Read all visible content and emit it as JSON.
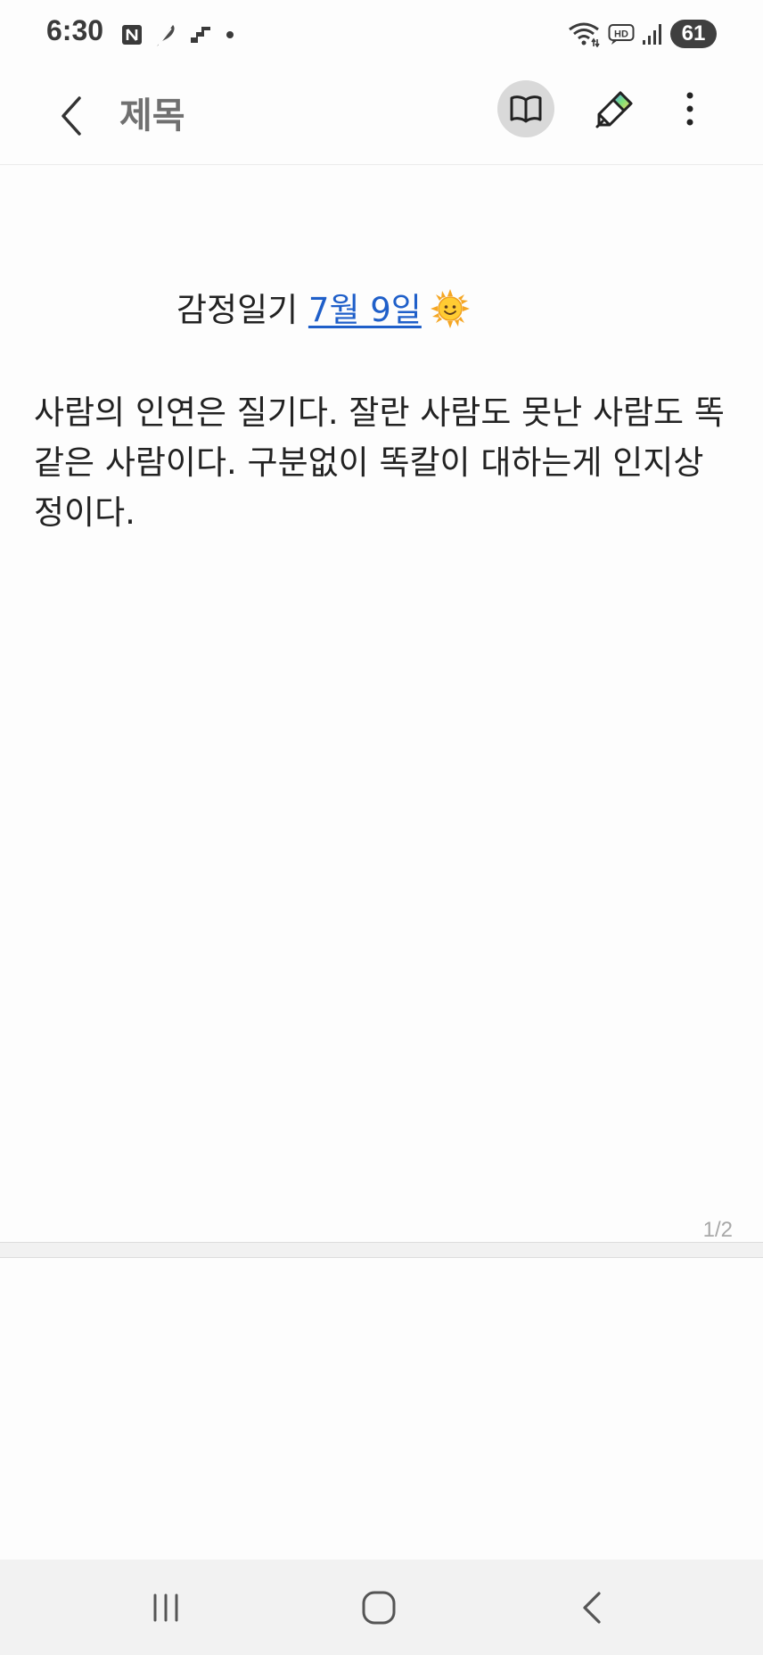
{
  "status_bar": {
    "time": "6:30",
    "battery": "61",
    "hd_label": "HD"
  },
  "app_bar": {
    "title": "제목"
  },
  "note": {
    "heading_prefix": "감정일기 ",
    "heading_date": "7월 9일",
    "body": "사람의 인연은 질기다. 잘란 사람도 못난 사람도 똑같은  사람이다. 구분없이 똑칼이 대하는게 인지상정이다.",
    "page_indicator": "1/2"
  },
  "icons": {
    "back": "chevron-left-icon",
    "reading_mode": "open-book-icon",
    "pen": "pen-icon",
    "more": "more-vertical-icon",
    "sun": "sun-face-emoji"
  },
  "colors": {
    "link": "#1f5fc9",
    "reading_button_bg": "#d9d9d9",
    "nav_bar_bg": "#f2f2f2"
  }
}
